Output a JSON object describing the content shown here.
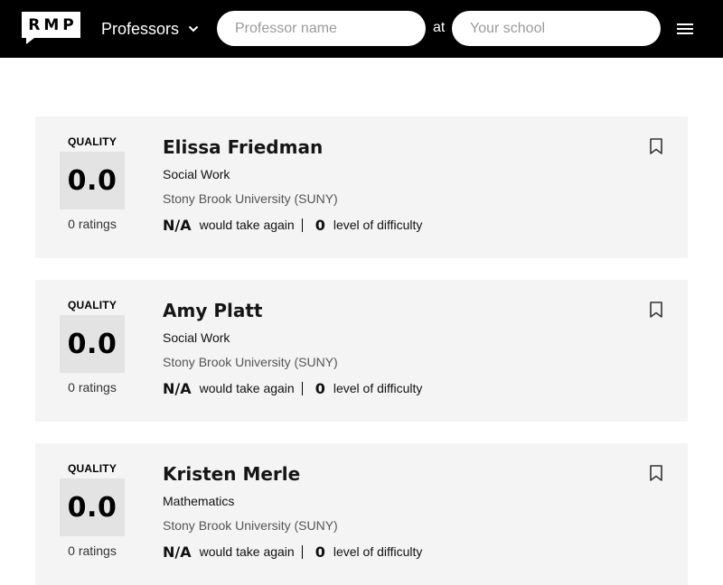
{
  "header": {
    "logo_text": "RMP",
    "search_type": "Professors",
    "professor_placeholder": "Professor name",
    "at_label": "at",
    "school_placeholder": "Your school"
  },
  "icons": {
    "type_dropdown": "chevron-down-icon",
    "menu": "hamburger-menu-icon",
    "save": "bookmark-icon"
  },
  "colors": {
    "header_bg": "#000000",
    "card_bg": "#f4f4f4",
    "quality_box": "#e3e3e3"
  },
  "results": [
    {
      "quality_label": "QUALITY",
      "quality": "0.0",
      "ratings": "0 ratings",
      "name": "Elissa Friedman",
      "department": "Social Work",
      "school": "Stony Brook University (SUNY)",
      "take_again": "N/A",
      "take_again_label": "would take again",
      "difficulty": "0",
      "difficulty_label": "level of difficulty"
    },
    {
      "quality_label": "QUALITY",
      "quality": "0.0",
      "ratings": "0 ratings",
      "name": "Amy Platt",
      "department": "Social Work",
      "school": "Stony Brook University (SUNY)",
      "take_again": "N/A",
      "take_again_label": "would take again",
      "difficulty": "0",
      "difficulty_label": "level of difficulty"
    },
    {
      "quality_label": "QUALITY",
      "quality": "0.0",
      "ratings": "0 ratings",
      "name": "Kristen Merle",
      "department": "Mathematics",
      "school": "Stony Brook University (SUNY)",
      "take_again": "N/A",
      "take_again_label": "would take again",
      "difficulty": "0",
      "difficulty_label": "level of difficulty"
    }
  ]
}
